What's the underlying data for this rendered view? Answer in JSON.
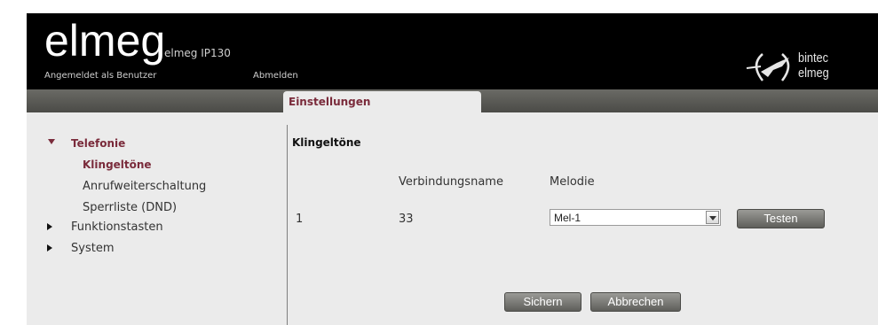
{
  "header": {
    "logo": "elmeg",
    "model": "elmeg IP130",
    "user_label": "Angemeldet als Benutzer",
    "logout_label": "Abmelden",
    "brand": "bintec elmeg"
  },
  "tabs": [
    {
      "label": "Einstellungen",
      "active": true
    }
  ],
  "nav": {
    "telefonie": "Telefonie",
    "klingeltoene": "Klingeltöne",
    "anrufweiterschaltung": "Anrufweiterschaltung",
    "sperrliste": "Sperrliste (DND)",
    "funktionstasten": "Funktionstasten",
    "system": "System"
  },
  "main": {
    "section_title": "Klingeltöne",
    "col_connection": "Verbindungsname",
    "col_melody": "Melodie",
    "rows": [
      {
        "index": "1",
        "name": "33",
        "melody": "Mel-1",
        "test_label": "Testen"
      }
    ],
    "save_label": "Sichern",
    "cancel_label": "Abbrechen"
  },
  "colors": {
    "accent": "#7a2b3b",
    "header_bg": "#000000",
    "content_bg": "#ebebeb",
    "button": "#6e6e6a"
  }
}
